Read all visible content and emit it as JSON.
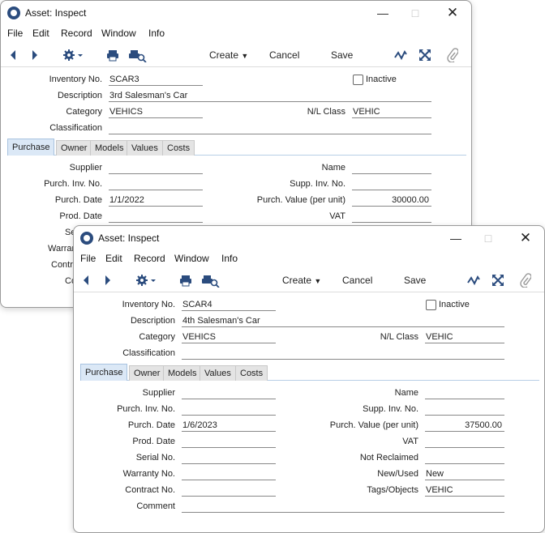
{
  "menu": [
    "File",
    "Edit",
    "Record",
    "Window",
    "Info"
  ],
  "toolbar": {
    "create": "Create",
    "cancel": "Cancel",
    "save": "Save"
  },
  "labels": {
    "inventory_no": "Inventory No.",
    "description": "Description",
    "category": "Category",
    "nl_class": "N/L Class",
    "classification": "Classification",
    "inactive": "Inactive",
    "supplier": "Supplier",
    "name": "Name",
    "purch_inv_no": "Purch. Inv. No.",
    "supp_inv_no": "Supp. Inv. No.",
    "purch_date": "Purch. Date",
    "purch_value": "Purch. Value (per unit)",
    "prod_date": "Prod. Date",
    "vat": "VAT",
    "serial_no": "Serial No.",
    "not_reclaimed": "Not Reclaimed",
    "warranty_no": "Warranty No.",
    "new_used": "New/Used",
    "contract_no": "Contract No.",
    "tags_objects": "Tags/Objects",
    "comment": "Comment"
  },
  "partial_labels": {
    "serial": "Se",
    "warranty": "Warrant",
    "contract": "Contr",
    "comment": "Co"
  },
  "tabs": [
    "Purchase",
    "Owner",
    "Models",
    "Values",
    "Costs"
  ],
  "window_back": {
    "title": "Asset: Inspect",
    "inventory_no": "SCAR3",
    "description": "3rd Salesman's Car",
    "category": "VEHICS",
    "nl_class": "VEHIC",
    "purch_date": "1/1/2022",
    "purch_value": "30000.00"
  },
  "window_front": {
    "title": "Asset: Inspect",
    "inventory_no": "SCAR4",
    "description": "4th Salesman's Car",
    "category": "VEHICS",
    "nl_class": "VEHIC",
    "purch_date": "1/6/2023",
    "purch_value": "37500.00",
    "new_used": "New",
    "tags_objects": "VEHIC"
  },
  "icons": [
    "app-logo-icon",
    "back-arrow-icon",
    "forward-arrow-icon",
    "gear-icon",
    "chevron-down-icon",
    "print-icon",
    "print-preview-icon",
    "activity-icon",
    "expand-icon",
    "paperclip-icon",
    "minimize-icon",
    "maximize-icon",
    "close-icon"
  ]
}
